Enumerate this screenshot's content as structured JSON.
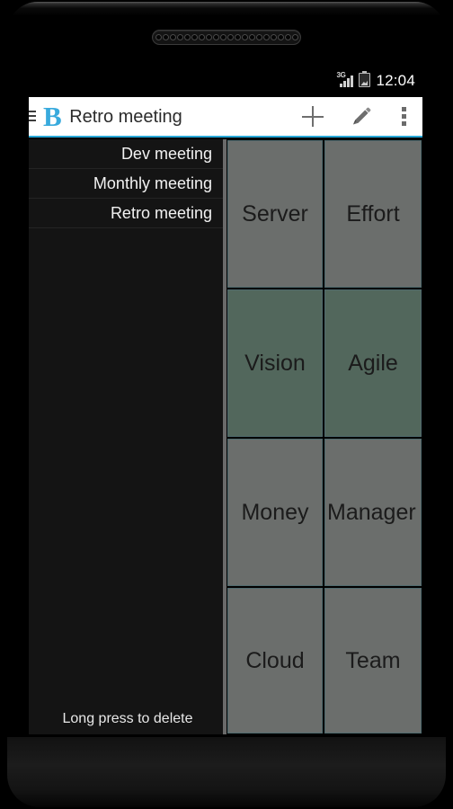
{
  "device": {
    "speaker_grille_holes": 20
  },
  "status_bar": {
    "network_type": "3G",
    "signal_icon": "signal-bars-icon",
    "battery_icon": "battery-charging-icon",
    "clock": "12:04"
  },
  "app_bar": {
    "drawer_icon": "hamburger-menu-icon",
    "logo_letter": "B",
    "title": "Retro meeting",
    "actions": [
      {
        "name": "add-button",
        "icon": "plus-icon"
      },
      {
        "name": "edit-button",
        "icon": "pencil-icon"
      },
      {
        "name": "overflow-button",
        "icon": "more-vertical-icon"
      }
    ]
  },
  "sidebar": {
    "items": [
      {
        "label": "Dev meeting",
        "selected": false
      },
      {
        "label": "Monthly meeting",
        "selected": false
      },
      {
        "label": "Retro meeting",
        "selected": true
      }
    ],
    "hint": "Long press to delete"
  },
  "grid": {
    "columns": 2,
    "tiles": [
      {
        "label": "Server",
        "color": "gray",
        "hex": "#6b6e6c"
      },
      {
        "label": "Effort",
        "color": "gray",
        "hex": "#6b6e6c"
      },
      {
        "label": "Vision",
        "color": "green",
        "hex": "#52675c"
      },
      {
        "label": "Agile",
        "color": "green",
        "hex": "#52675c"
      },
      {
        "label": "Money",
        "color": "gray",
        "hex": "#6b6e6c"
      },
      {
        "label": "Manager",
        "color": "gray",
        "hex": "#6b6e6c"
      },
      {
        "label": "Cloud",
        "color": "gray",
        "hex": "#6b6e6c"
      },
      {
        "label": "Team",
        "color": "gray",
        "hex": "#6b6e6c"
      }
    ]
  },
  "colors": {
    "accent": "#29a8d8",
    "logo": "#38aadd",
    "sidebar_bg": "#141414",
    "tile_border": "#4f6a6e",
    "tile_gray": "#6b6e6c",
    "tile_green": "#52675c"
  }
}
